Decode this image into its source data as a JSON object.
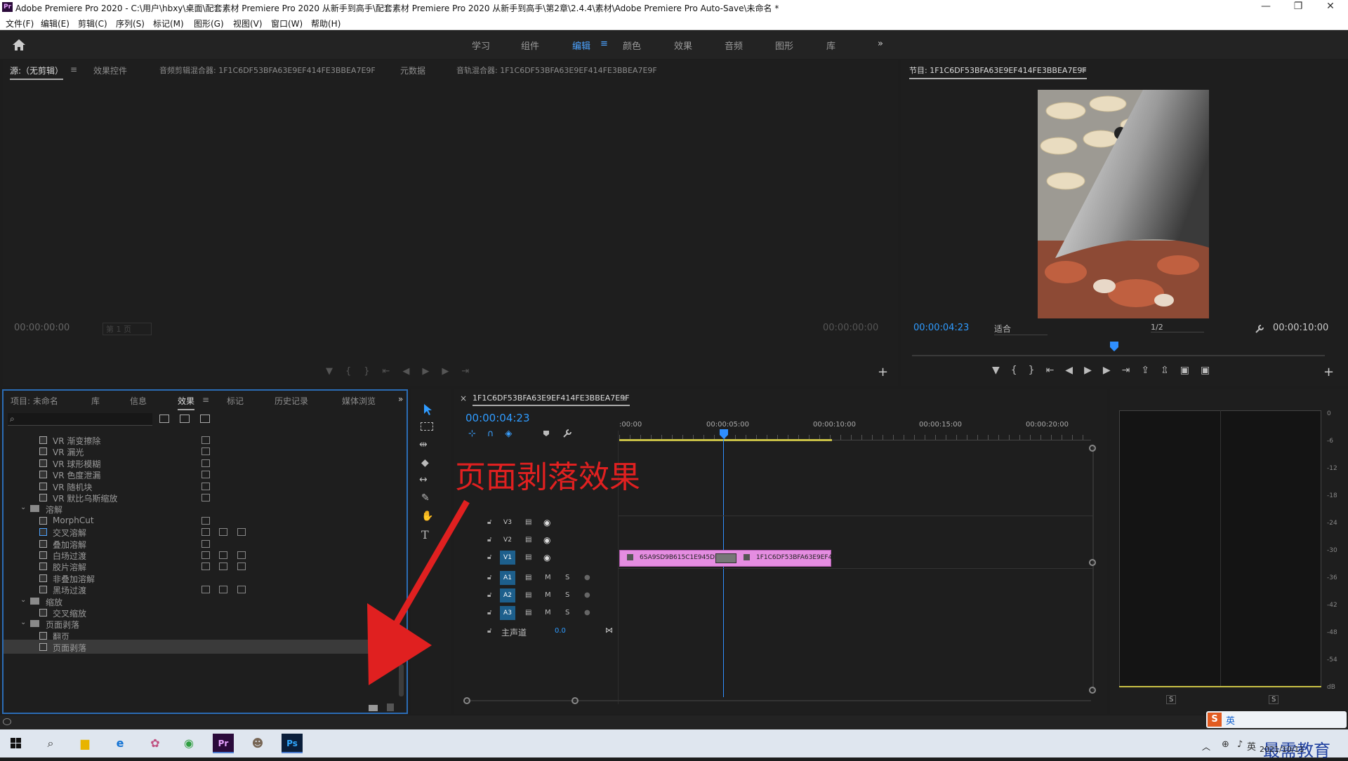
{
  "window": {
    "title": "Adobe Premiere Pro 2020 - C:\\用户\\hbxy\\桌面\\配套素材 Premiere Pro 2020 从新手到高手\\配套素材 Premiere Pro 2020 从新手到高手\\第2章\\2.4.4\\素材\\Adobe Premiere Pro Auto-Save\\未命名 *",
    "logo": "Pr",
    "minimize": "—",
    "restore": "❐",
    "close": "✕"
  },
  "menu": [
    "文件(F)",
    "编辑(E)",
    "剪辑(C)",
    "序列(S)",
    "标记(M)",
    "图形(G)",
    "视图(V)",
    "窗口(W)",
    "帮助(H)"
  ],
  "workspaces": {
    "home_icon": "home-icon",
    "items": [
      "学习",
      "组件",
      "编辑",
      "颜色",
      "效果",
      "音频",
      "图形",
      "库"
    ],
    "active": "编辑",
    "active_menu": "≡",
    "overflow": "»"
  },
  "source_panel": {
    "tabs": [
      "源:（无剪辑）",
      "效果控件",
      "音频剪辑混合器: 1F1C6DF53BFA63E9EF414FE3BBEA7E9F",
      "元数据",
      "音轨混合器: 1F1C6DF53BFA63E9EF414FE3BBEA7E9F"
    ],
    "tab_menu": "≡",
    "timecode_left": "00:00:00:00",
    "page_select": "第 1 页",
    "timecode_right": "00:00:00:00",
    "add": "+"
  },
  "program_panel": {
    "title": "节目: 1F1C6DF53BFA63E9EF414FE3BBEA7E9F",
    "menu": "≡",
    "timecode": "00:00:04:23",
    "fit": "适合",
    "resolution": "1/2",
    "duration": "00:00:10:00",
    "playhead_fraction": 0.49,
    "add": "+"
  },
  "project_panel": {
    "tabs": [
      "项目: 未命名",
      "库",
      "信息",
      "效果",
      "标记",
      "历史记录",
      "媒体浏览"
    ],
    "active": "效果",
    "active_menu": "≡",
    "overflow": "»",
    "search_icon": "⌕",
    "tree": [
      {
        "type": "item",
        "label": "VR 渐变擦除",
        "badges": 1
      },
      {
        "type": "item",
        "label": "VR 漏光",
        "badges": 1
      },
      {
        "type": "item",
        "label": "VR 球形模糊",
        "badges": 1
      },
      {
        "type": "item",
        "label": "VR 色度泄漏",
        "badges": 1
      },
      {
        "type": "item",
        "label": "VR 随机块",
        "badges": 1
      },
      {
        "type": "item",
        "label": "VR 默比乌斯缩放",
        "badges": 1
      },
      {
        "type": "folder",
        "label": "溶解"
      },
      {
        "type": "item",
        "label": "MorphCut",
        "badges": 1
      },
      {
        "type": "item",
        "label": "交叉溶解",
        "badges": 3,
        "selected_box": true
      },
      {
        "type": "item",
        "label": "叠加溶解",
        "badges": 1
      },
      {
        "type": "item",
        "label": "白场过渡",
        "badges": 3
      },
      {
        "type": "item",
        "label": "胶片溶解",
        "badges": 3
      },
      {
        "type": "item",
        "label": "非叠加溶解",
        "badges": 0
      },
      {
        "type": "item",
        "label": "黑场过渡",
        "badges": 3
      },
      {
        "type": "folder",
        "label": "缩放"
      },
      {
        "type": "item",
        "label": "交叉缩放",
        "badges": 0
      },
      {
        "type": "folder",
        "label": "页面剥落"
      },
      {
        "type": "item",
        "label": "翻页",
        "badges": 0
      },
      {
        "type": "item",
        "label": "页面剥落",
        "badges": 0,
        "highlighted": true
      }
    ]
  },
  "annotation": {
    "text": "页面剥落效果",
    "color": "#e02020"
  },
  "timeline": {
    "close": "×",
    "sequence_name": "1F1C6DF53BFA63E9EF414FE3BBEA7E9F",
    "menu": "≡",
    "timecode": "00:00:04:23",
    "ruler": [
      ":00:00",
      "00:00:05:00",
      "00:00:10:00",
      "00:00:15:00",
      "00:00:20:00"
    ],
    "video_tracks": [
      "V3",
      "V2",
      "V1"
    ],
    "audio_tracks": [
      "A1",
      "A2",
      "A3"
    ],
    "mute": "M",
    "solo": "S",
    "master_label": "主声道",
    "master_value": "0.0",
    "clip_a": "6SA9SD9B615C1E945DE",
    "clip_b": "1F1C6DF53BFA63E9EF41",
    "clip_color": "#e58de1"
  },
  "vu_meter": {
    "scale": [
      "0",
      "-6",
      "-12",
      "-18",
      "-24",
      "-30",
      "-36",
      "-42",
      "-48",
      "-54",
      "dB"
    ],
    "solo_left": "S",
    "solo_right": "S"
  },
  "taskbar": {
    "date": "2021/10/11",
    "ime": "英",
    "brand": "最需教育",
    "icons": [
      "windows-start-icon",
      "search-icon",
      "file-explorer-icon",
      "edge-icon",
      "paint-icon",
      "chrome-icon",
      "premiere-icon",
      "avatar-app-icon",
      "photoshop-icon"
    ]
  }
}
